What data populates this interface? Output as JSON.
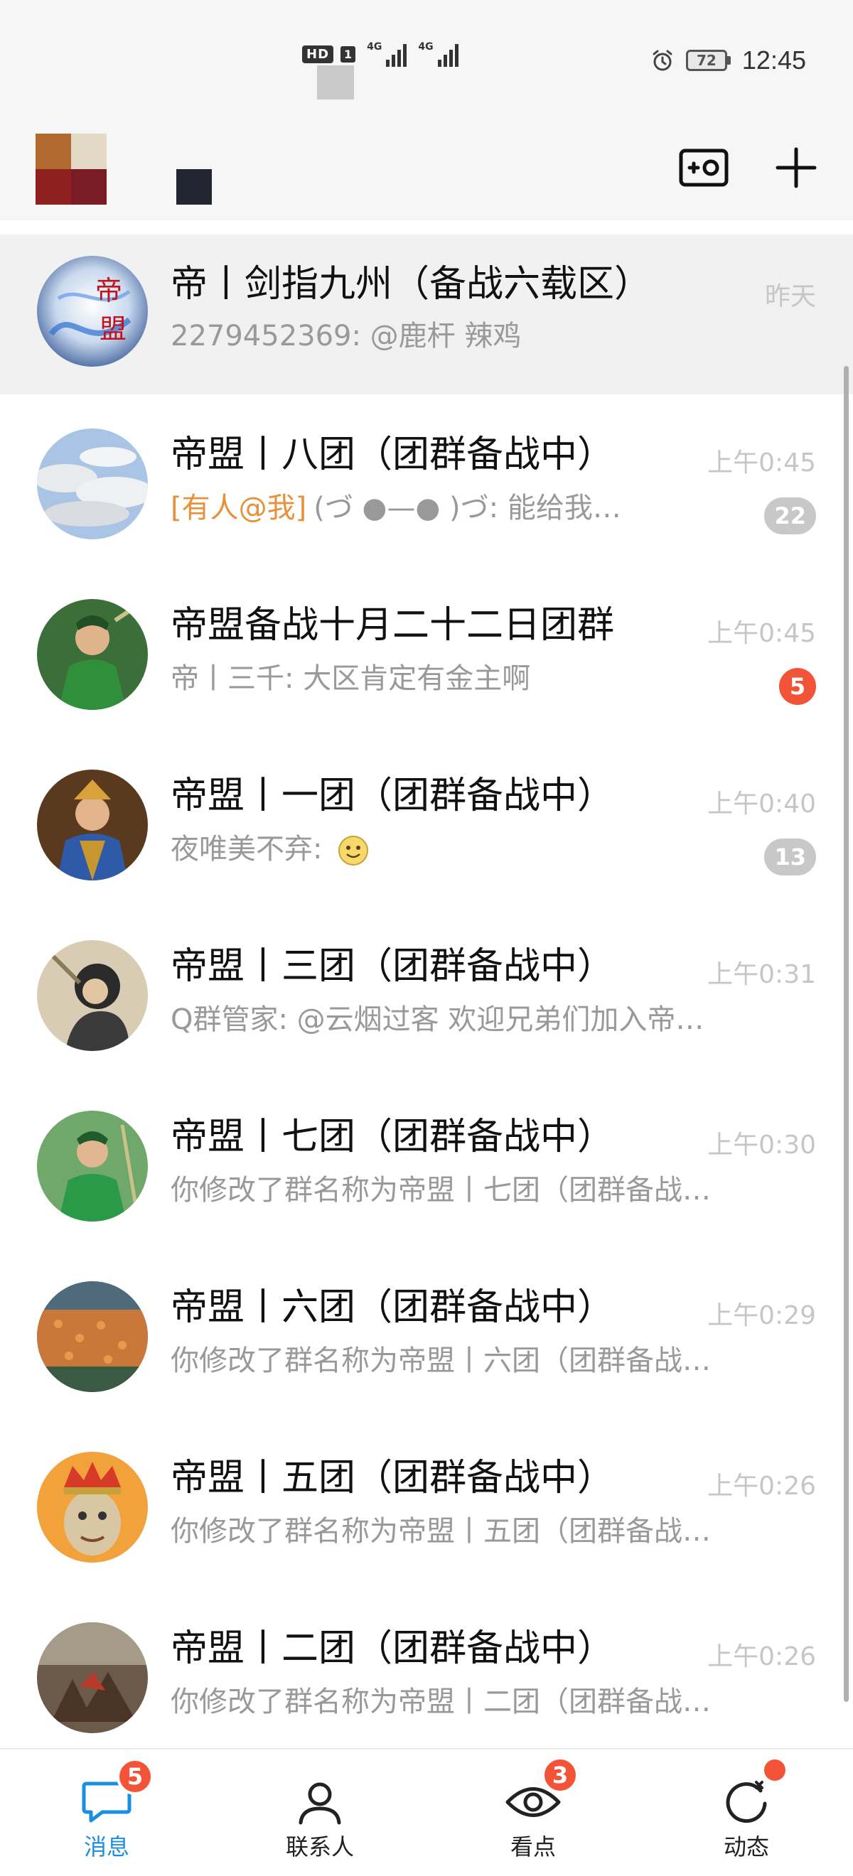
{
  "status_bar": {
    "hd_label": "HD",
    "sim1": "1",
    "net1": "4G",
    "net2": "4G",
    "battery": "72",
    "time": "12:45"
  },
  "header": {
    "left_icon": "camera-plus-icon",
    "right_icon": "plus-icon"
  },
  "conversations": [
    {
      "title": "帝丨剑指九州（备战六载区）",
      "mention": "",
      "preview": "2279452369: @鹿杆 辣鸡",
      "time": "昨天",
      "badge": "",
      "pinned": true
    },
    {
      "title": "帝盟丨八团（团群备战中）",
      "mention": "[有人@我]",
      "preview": "(づ ●—● )づ: 能给我…",
      "time": "上午0:45",
      "badge": "22",
      "badge_style": "muted"
    },
    {
      "title": "帝盟备战十月二十二日团群",
      "mention": "",
      "preview": "帝丨三千: 大区肯定有金主啊",
      "time": "上午0:45",
      "badge": "5",
      "badge_style": "alert"
    },
    {
      "title": "帝盟丨一团（团群备战中）",
      "mention": "",
      "preview": "夜唯美不弃: ",
      "emoji": "smile-emoji",
      "time": "上午0:40",
      "badge": "13",
      "badge_style": "muted"
    },
    {
      "title": "帝盟丨三团（团群备战中）",
      "mention": "",
      "preview": "Q群管家: @云烟过客 欢迎兄弟们加入帝…",
      "time": "上午0:31",
      "badge": ""
    },
    {
      "title": "帝盟丨七团（团群备战中）",
      "mention": "",
      "preview": "你修改了群名称为帝盟丨七团（团群备战…",
      "time": "上午0:30",
      "badge": ""
    },
    {
      "title": "帝盟丨六团（团群备战中）",
      "mention": "",
      "preview": "你修改了群名称为帝盟丨六团（团群备战…",
      "time": "上午0:29",
      "badge": ""
    },
    {
      "title": "帝盟丨五团（团群备战中）",
      "mention": "",
      "preview": "你修改了群名称为帝盟丨五团（团群备战…",
      "time": "上午0:26",
      "badge": ""
    },
    {
      "title": "帝盟丨二团（团群备战中）",
      "mention": "",
      "preview": "你修改了群名称为帝盟丨二团（团群备战…",
      "time": "上午0:26",
      "badge": ""
    }
  ],
  "tabs": [
    {
      "label": "消息",
      "icon": "chat-bubble-icon",
      "badge": "5",
      "active": true
    },
    {
      "label": "联系人",
      "icon": "person-icon",
      "badge": ""
    },
    {
      "label": "看点",
      "icon": "eye-icon",
      "badge": "3"
    },
    {
      "label": "动态",
      "icon": "refresh-star-icon",
      "badge": "",
      "dot": true
    }
  ],
  "colors": {
    "accent": "#1a8fe0",
    "alert_badge": "#f35336",
    "muted_badge": "#c8c8c8",
    "mention": "#e8913a"
  }
}
